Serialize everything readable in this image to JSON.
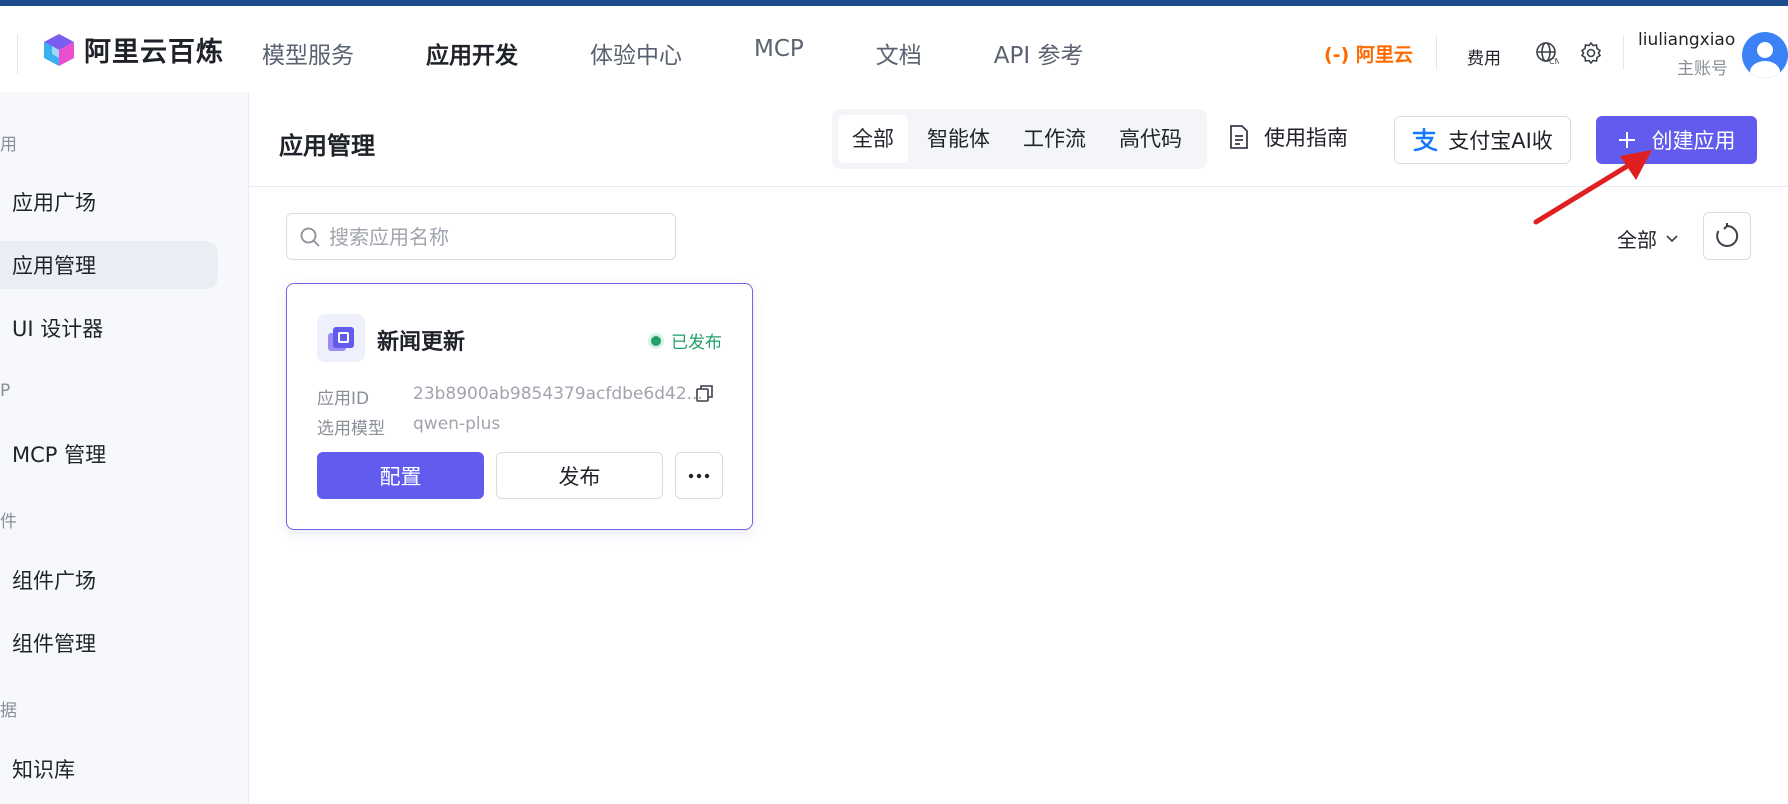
{
  "header": {
    "logo_text": "阿里云百炼",
    "nav": [
      {
        "label": "模型服务"
      },
      {
        "label": "应用开发"
      },
      {
        "label": "体验中心"
      },
      {
        "label": "MCP"
      },
      {
        "label": "文档"
      },
      {
        "label": "API 参考"
      }
    ],
    "active_nav": "应用开发",
    "aliyun_label": "(-) 阿里云",
    "fee_label": "费用",
    "user_name": "liuliangxiao",
    "user_role": "主账号"
  },
  "sidebar": {
    "groups": [
      "用",
      "P",
      "件",
      "据"
    ],
    "items": [
      {
        "label": "应用广场"
      },
      {
        "label": "应用管理"
      },
      {
        "label": "UI 设计器"
      },
      {
        "label": "MCP 管理"
      },
      {
        "label": "组件广场"
      },
      {
        "label": "组件管理"
      },
      {
        "label": "知识库"
      }
    ]
  },
  "main": {
    "title": "应用管理",
    "tabs": [
      {
        "label": "全部"
      },
      {
        "label": "智能体"
      },
      {
        "label": "工作流"
      },
      {
        "label": "高代码"
      }
    ],
    "guide_label": "使用指南",
    "alipay_label": "支付宝AI收",
    "create_label": "创建应用",
    "search_placeholder": "搜索应用名称",
    "filter_label": "全部"
  },
  "card": {
    "name": "新闻更新",
    "status": "已发布",
    "id_label": "应用ID",
    "id_value": "23b8900ab9854379acfdbe6d42...",
    "model_label": "选用模型",
    "model_value": "qwen-plus",
    "config_label": "配置",
    "publish_label": "发布"
  },
  "colors": {
    "accent": "#615ced",
    "published": "#22a06b",
    "aliyun": "#ff6a00",
    "annotation_arrow": "#e02020"
  }
}
